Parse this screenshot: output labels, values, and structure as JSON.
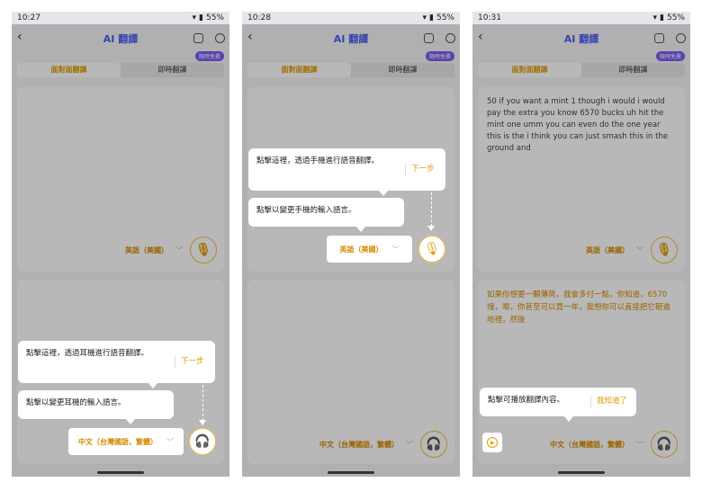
{
  "app": {
    "title": "AI 翻譯",
    "badge": "限時免費",
    "tab_face": "面對面翻譯",
    "tab_live": "即時翻譯"
  },
  "status": {
    "panel1_time": "10:27",
    "panel2_time": "10:28",
    "panel3_time": "10:31",
    "battery": "55%"
  },
  "languages": {
    "upper": "英語（美國）",
    "lower": "中文（台灣國語，繁體）"
  },
  "panel1": {
    "tip_main": "點擊這裡，透過耳機進行語音翻譯。",
    "tip_next": "下一步",
    "tip_lang": "點擊以變更耳機的輸入語言。"
  },
  "panel2": {
    "tip_main": "點擊這裡，透過手機進行語音翻譯。",
    "tip_next": "下一步",
    "tip_lang": "點擊以變更手機的輸入語言。"
  },
  "panel3": {
    "transcript": "50 if you want a mint 1 though i would i would pay the extra you know 6570 bucks uh hit the mint one umm you can even do the one year this is the i think you can just smash this in the ground and",
    "translation": "如果你想要一顆薄荷，我會多付一點，你知道，6570塊，嗯，你甚至可以買一年，我想你可以直接把它砸進地裡，然後",
    "tip_play": "點擊可播放翻譯內容。",
    "tip_ok": "我知道了"
  },
  "colors": {
    "accent": "#e09b00",
    "brand": "#4a5cf0",
    "badge": "#7c5cf0"
  }
}
